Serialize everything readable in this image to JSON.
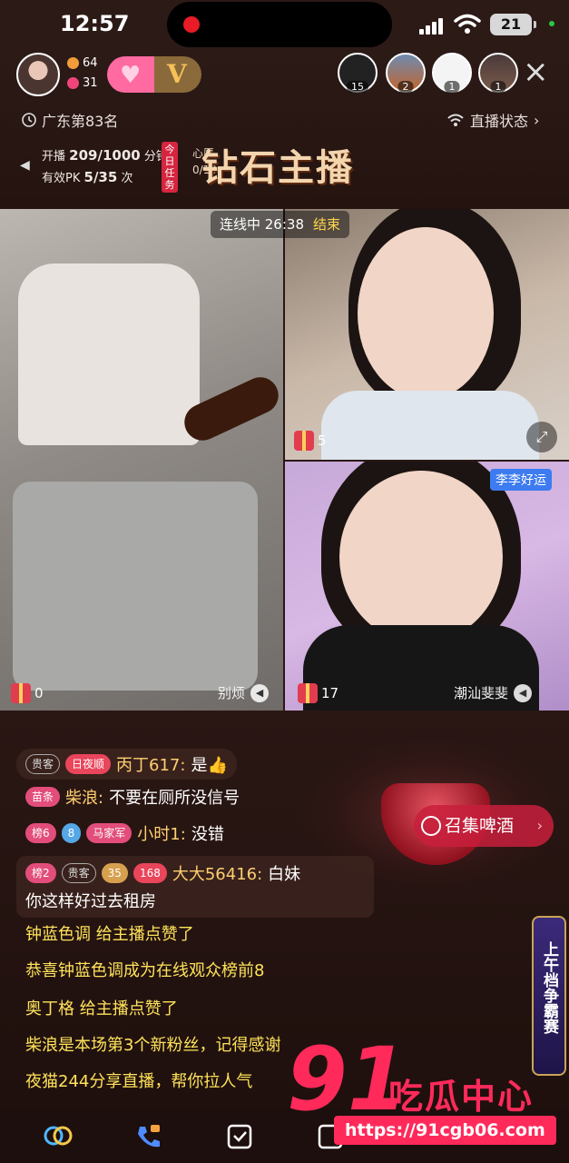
{
  "status_bar": {
    "time": "12:57",
    "battery": "21"
  },
  "header": {
    "stat_followers": "64",
    "stat_likes": "31",
    "badge_letter": "V",
    "rank_counts": [
      "15",
      "2",
      "1",
      "1"
    ],
    "location": "广东第83名",
    "live_status": "直播状态",
    "task_line1_prefix": "开播",
    "task_line1_value": "209/1000",
    "task_line1_suffix": "分钟",
    "task_line2_prefix": "有效PK",
    "task_line2_value": "5/35",
    "task_line2_suffix": "次",
    "today_task": "今日任务",
    "wish_label": "心愿",
    "wish_value": "0/10",
    "diamond_title": "钻石主播"
  },
  "video": {
    "connecting_label": "连线中 26:38",
    "end_label": "结束",
    "left_gift_count": "0",
    "left_name": "别烦",
    "tr_gift_count": "5",
    "br_gift_count": "17",
    "br_name_tag": "李李好运",
    "br_name": "潮汕斐斐"
  },
  "chat": {
    "cta_label": "召集啤酒",
    "lines": [
      {
        "tags": [
          "贵客",
          "日夜顺"
        ],
        "user": "丙丁617:",
        "msg": "是👍"
      },
      {
        "tags": [
          "苗条"
        ],
        "user": "柴浪:",
        "msg": "不要在厕所没信号"
      },
      {
        "tags": [
          "榜6",
          "8",
          "马家军"
        ],
        "user": "小时1:",
        "msg": "没错"
      },
      {
        "tags": [
          "榜2",
          "贵客",
          "35",
          "168"
        ],
        "user": "大大56416:",
        "msg": "白妹",
        "msg2": "你这样好过去租房"
      }
    ],
    "system": [
      "钟蓝色调 给主播点赞了",
      "恭喜钟蓝色调成为在线观众榜前8",
      "奥丁格 给主播点赞了",
      "柴浪是本场第3个新粉丝，记得感谢",
      "夜猫244分享直播，帮你拉人气"
    ],
    "side_banner": "上午档争霸赛"
  },
  "watermark": {
    "big": "91",
    "text": "吃瓜中心",
    "url": "https://91cgb06.com"
  },
  "colors": {
    "accent": "#ff2a5a",
    "username": "#ffcf70",
    "system": "#ffe35a"
  }
}
